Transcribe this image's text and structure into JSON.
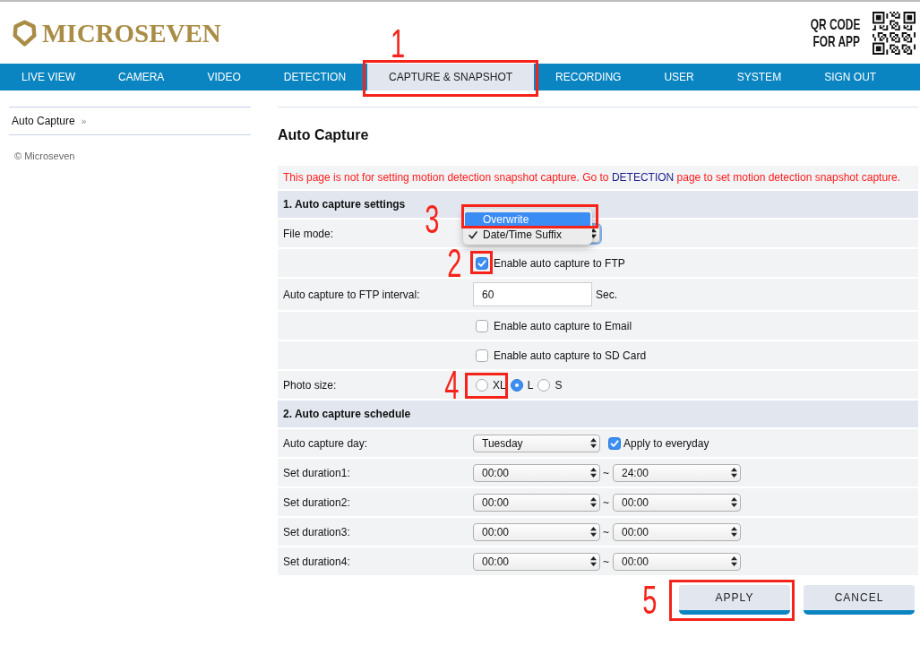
{
  "header": {
    "brand": "MICROSEVEN",
    "qr_caption": [
      "QR CODE",
      "FOR APP"
    ]
  },
  "nav": [
    {
      "label": "LIVE VIEW",
      "selected": false
    },
    {
      "label": "CAMERA",
      "selected": false
    },
    {
      "label": "VIDEO",
      "selected": false
    },
    {
      "label": "DETECTION",
      "selected": false
    },
    {
      "label": "CAPTURE & SNAPSHOT",
      "selected": true,
      "callout": "1"
    },
    {
      "label": "RECORDING",
      "selected": false
    },
    {
      "label": "USER",
      "selected": false
    },
    {
      "label": "SYSTEM",
      "selected": false
    },
    {
      "label": "SIGN OUT",
      "selected": false
    }
  ],
  "sidebar": {
    "items": [
      {
        "label": "Auto Capture",
        "marker": "»"
      }
    ],
    "copyright": "© Microseven"
  },
  "main": {
    "title": "Auto Capture",
    "notice": {
      "before": "This page is not for setting motion detection snapshot capture. Go to",
      "link": "DETECTION",
      "after": "page to set motion detection snapshot capture."
    },
    "sections": [
      {
        "title": "1. Auto capture settings",
        "rows": [
          {
            "kind": "select",
            "label": "File mode:",
            "open": true,
            "options": [
              {
                "label": "Overwrite",
                "highlighted": true,
                "selected": false,
                "callout": "3"
              },
              {
                "label": "Date/Time Suffix",
                "highlighted": false,
                "selected": true
              }
            ]
          },
          {
            "kind": "checkbox",
            "label": "Enable auto capture to FTP",
            "checked": true,
            "callout": "2"
          },
          {
            "kind": "input",
            "label": "Auto capture to FTP interval:",
            "value": "60",
            "unit": "Sec."
          },
          {
            "kind": "checkbox",
            "label": "Enable auto capture to Email",
            "checked": false
          },
          {
            "kind": "checkbox",
            "label": "Enable auto capture to SD Card",
            "checked": false
          },
          {
            "kind": "radio",
            "label": "Photo size:",
            "options": [
              {
                "label": "XL",
                "selected": false,
                "callout": "4"
              },
              {
                "label": "L",
                "selected": true
              },
              {
                "label": "S",
                "selected": false
              }
            ]
          }
        ]
      },
      {
        "title": "2. Auto capture schedule",
        "rows": [
          {
            "kind": "select",
            "label": "Auto capture day:",
            "value": "Tuesday",
            "open": false,
            "check": {
              "label": "Apply to everyday",
              "checked": true
            }
          },
          {
            "kind": "range",
            "label": "Set duration1:",
            "from": "00:00",
            "separator": "~",
            "to": "24:00"
          },
          {
            "kind": "range",
            "label": "Set duration2:",
            "from": "00:00",
            "separator": "~",
            "to": "00:00"
          },
          {
            "kind": "range",
            "label": "Set duration3:",
            "from": "00:00",
            "separator": "~",
            "to": "00:00"
          },
          {
            "kind": "range",
            "label": "Set duration4:",
            "from": "00:00",
            "separator": "~",
            "to": "00:00"
          }
        ]
      }
    ],
    "buttons": [
      {
        "label": "APPLY",
        "callout": "5"
      },
      {
        "label": "CANCEL"
      }
    ]
  }
}
